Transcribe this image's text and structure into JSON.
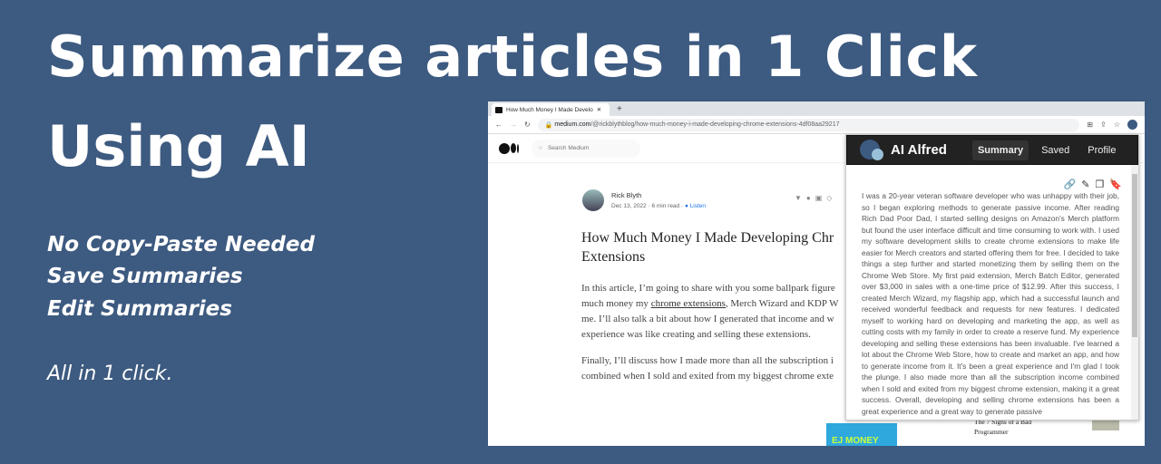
{
  "hero": {
    "line1": "Summarize articles in 1 Click",
    "line2": "Using AI",
    "features": [
      "No Copy-Paste Needed",
      "Save Summaries",
      "Edit Summaries"
    ],
    "tagline": "All in 1 click."
  },
  "browser": {
    "tab_title": "How Much Money I Made Develo",
    "url_domain": "medium.com",
    "url_path": "/@rickblythblog/how-much-money-i-made-developing-chrome-extensions-4df08aa29217"
  },
  "medium": {
    "search_placeholder": "Search Medium",
    "author": "Rick Blyth",
    "date": "Dec 13, 2022",
    "read_time": "6 min read",
    "listen": "Listen",
    "title": "How Much Money I Made Developing Chr Extensions",
    "p1a": "In this article, I’m going to share with you some ballpark figure",
    "p1b": "much money my ",
    "p1link": "chrome extensions",
    "p1c": ", Merch Wizard and KDP W",
    "p1d": "me. I’ll also talk a bit about how I generated that income and w",
    "p1e": "experience was like creating and selling these extensions.",
    "p2a": "Finally, I’ll discuss how I made more than all the subscription i",
    "p2b": "combined when I sold and exited from my biggest chrome exte",
    "ad_text": "EJ MONEY",
    "rec_line1": "The 7 Signs of a Bad",
    "rec_line2": "Programmer"
  },
  "popup": {
    "name": "AI Alfred",
    "tabs": [
      "Summary",
      "Saved",
      "Profile"
    ],
    "active_tab": "Summary",
    "accent": "#f08a5d",
    "summary": "I was a 20-year veteran software developer who was unhappy with their job, so I began exploring methods to generate passive income. After reading Rich Dad Poor Dad, I started selling designs on Amazon's Merch platform but found the user interface difficult and time consuming to work with. I used my software development skills to create chrome extensions to make life easier for Merch creators and started offering them for free. I decided to take things a step further and started monetizing them by selling them on the Chrome Web Store. My first paid extension, Merch Batch Editor, generated over $3,000 in sales with a one-time price of $12.99. After this success, I created Merch Wizard, my flagship app, which had a successful launch and received wonderful feedback and requests for new features. I dedicated myself to working hard on developing and marketing the app, as well as cutting costs with my family in order to create a reserve fund. My experience developing and selling these extensions has been invaluable. I've learned a lot about the Chrome Web Store, how to create and market an app, and how to generate income from it. It's been a great experience and I'm glad I took the plunge. I also made more than all the subscription income combined when I sold and exited from my biggest chrome extension, making it a great success. Overall, developing and selling chrome extensions has been a great experience and a great way to generate passive"
  }
}
